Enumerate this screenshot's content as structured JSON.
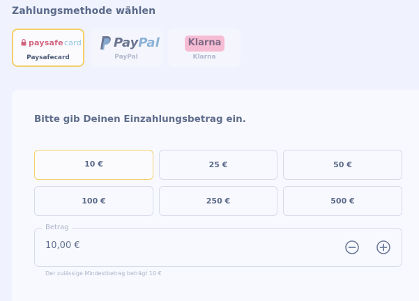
{
  "section_title": "Zahlungsmethode wählen",
  "methods": [
    {
      "id": "paysafecard",
      "label": "Paysafecard",
      "logo_text_primary": "paysafe",
      "logo_text_secondary": "card",
      "selected": true
    },
    {
      "id": "paypal",
      "label": "PayPal",
      "logo_text_primary": "Pay",
      "logo_text_secondary": "Pal",
      "selected": false
    },
    {
      "id": "klarna",
      "label": "Klarna",
      "logo_text": "Klarna",
      "selected": false
    }
  ],
  "deposit": {
    "prompt": "Bitte gib Deinen Einzahlungsbetrag ein.",
    "amounts": [
      "10 €",
      "25 €",
      "50 €",
      "100 €",
      "250 €",
      "500 €"
    ],
    "selected_amount": "10 €",
    "field_label": "Betrag",
    "field_value": "10,00 €",
    "min_hint": "Der zulässige Mindestbetrag beträgt 10 €",
    "decrement_icon": "minus-circle-icon",
    "increment_icon": "plus-circle-icon"
  },
  "colors": {
    "page_bg": "#f0f2fd",
    "panel_bg": "#f8f9fe",
    "selected_border": "#f4d06a",
    "text": "#5b6a8a",
    "muted": "#aab3c8"
  }
}
